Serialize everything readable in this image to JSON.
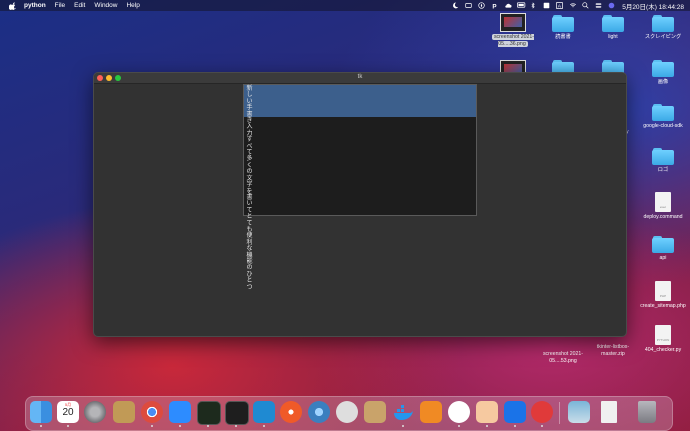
{
  "menubar": {
    "app_name": "python",
    "items": [
      "File",
      "Edit",
      "Window",
      "Help"
    ],
    "clock": "5月20日(木) 18:44:28",
    "status_icons": [
      "moon-icon",
      "bar-icon",
      "compass-icon",
      "p-icon",
      "cloud-icon",
      "battery-icon",
      "bluetooth-icon",
      "keyboard-icon",
      "mirror-icon",
      "a-icon",
      "wifi-icon",
      "search-icon",
      "control-center-icon",
      "siri-icon"
    ]
  },
  "window": {
    "title": "tk",
    "list_text": "新しい手書き入力すべて多くの文字を書いてとても便利な機能のひとつ"
  },
  "desktop_icons": [
    {
      "name": "screenshot-1",
      "label": "screenshot 2021-05....36.png",
      "type": "thumb",
      "selected": true
    },
    {
      "name": "folder-dokusho",
      "label": "読書書",
      "type": "folder"
    },
    {
      "name": "folder-light",
      "label": "light",
      "type": "folder"
    },
    {
      "name": "folder-scraping",
      "label": "スクレイピング",
      "type": "folder"
    },
    {
      "name": "screenshot-2",
      "label": "",
      "type": "thumb"
    },
    {
      "name": "folder-blank-1",
      "label": "",
      "type": "folder"
    },
    {
      "name": "folder-blank-2",
      "label": "",
      "type": "folder"
    },
    {
      "name": "folder-gazou",
      "label": "画像",
      "type": "folder"
    },
    {
      "name": "folder-xy",
      "label": "xy",
      "type": "folder"
    },
    {
      "name": "folder-google-cloud-sdk",
      "label": "google-cloud-sdk",
      "type": "folder"
    },
    {
      "name": "folder-logo",
      "label": "ロゴ",
      "type": "folder"
    },
    {
      "name": "file-deploy-command",
      "label": "deploy.command",
      "type": "doc",
      "tag": "exec"
    },
    {
      "name": "folder-api",
      "label": "api",
      "type": "folder"
    },
    {
      "name": "file-create-sitemap",
      "label": "create_sitemap.php",
      "type": "doc",
      "tag": "PHP"
    },
    {
      "name": "file-404-checker",
      "label": "404_checker.py",
      "type": "doc",
      "tag": "PYTHON"
    },
    {
      "name": "screenshot-3",
      "label": "screenshot 2021-05....53.png",
      "type": "none"
    },
    {
      "name": "file-tkinter-listbox",
      "label": "tkinter-listbox-master.zip",
      "type": "none"
    }
  ],
  "dock": {
    "apps": [
      {
        "name": "finder",
        "color": "#4aa8f0"
      },
      {
        "name": "calendar",
        "color": "#ffffff",
        "text": "20",
        "subtext": "5月"
      },
      {
        "name": "system-preferences",
        "color": "#8e8e93"
      },
      {
        "name": "library",
        "color": "#c19a56"
      },
      {
        "name": "chrome",
        "color": "#e9e9e9"
      },
      {
        "name": "zoom",
        "color": "#2d8cff"
      },
      {
        "name": "activity-terminal",
        "color": "#2c2c2c"
      },
      {
        "name": "terminal",
        "color": "#1e1e1e"
      },
      {
        "name": "vscode",
        "color": "#1f8ad2"
      },
      {
        "name": "safari",
        "color": "#f05a28"
      },
      {
        "name": "quicktime",
        "color": "#3b7fbf"
      },
      {
        "name": "sequel-pro",
        "color": "#dedede"
      },
      {
        "name": "archive",
        "color": "#c9a36a"
      },
      {
        "name": "docker",
        "color": "#2496ed"
      },
      {
        "name": "sourcetree",
        "color": "#f08a24"
      },
      {
        "name": "git-client",
        "color": "#ffffff"
      },
      {
        "name": "python-launcher",
        "color": "#f6c9a0"
      },
      {
        "name": "infinity-app",
        "color": "#1a73e8"
      },
      {
        "name": "clock-app",
        "color": "#e03a3a"
      },
      {
        "name": "preview",
        "color": "#7ab5d8"
      },
      {
        "name": "document",
        "color": "#f0f0f0"
      },
      {
        "name": "trash",
        "color": "#9a9aa0"
      }
    ]
  }
}
